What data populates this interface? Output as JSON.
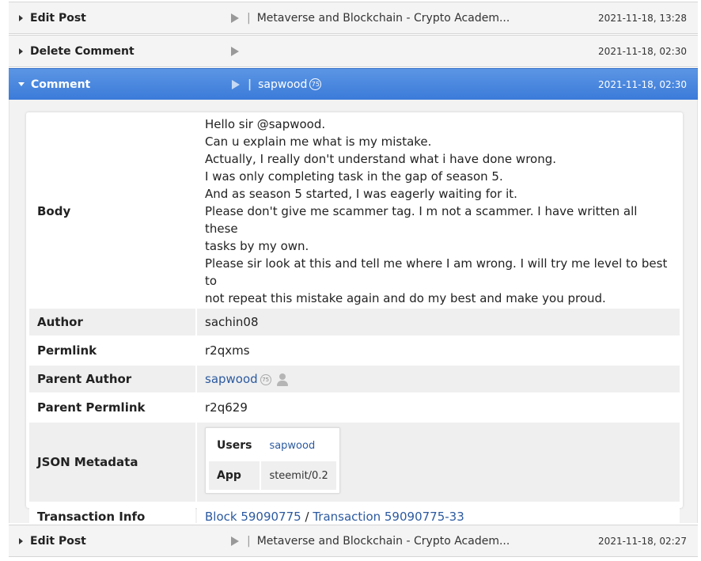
{
  "operations": [
    {
      "type": "Edit Post",
      "summary": "Metaverse and Blockchain - Crypto Academ...",
      "time": "2021-11-18, 13:28"
    },
    {
      "type": "Delete Comment",
      "summary": "",
      "time": "2021-11-18, 02:30"
    },
    {
      "type": "Comment",
      "summary": "sapwood",
      "reputation": "75",
      "time": "2021-11-18, 02:30"
    },
    {
      "type": "Edit Post",
      "summary": "Metaverse and Blockchain - Crypto Academ...",
      "time": "2021-11-18, 02:27"
    }
  ],
  "details": {
    "body_label": "Body",
    "body_lines": [
      "Hello sir @sapwood.",
      "Can u explain me what is my mistake.",
      "Actually, I really don't understand what i have done wrong.",
      "I was only completing task in the gap of season 5.",
      "And as season 5 started, I was eagerly waiting for it.",
      "Please don't give me scammer tag. I m not a scammer. I have written all these",
      "tasks by my own.",
      "Please sir look at this and tell me where I am wrong. I will try me level to best to",
      "not repeat this mistake again and do my best and make you proud."
    ],
    "author_label": "Author",
    "author": "sachin08",
    "permlink_label": "Permlink",
    "permlink": "r2qxms",
    "parent_author_label": "Parent Author",
    "parent_author": "sapwood",
    "parent_author_reputation": "75",
    "parent_permlink_label": "Parent Permlink",
    "parent_permlink": "r2q629",
    "json_metadata_label": "JSON Metadata",
    "json_metadata": {
      "users_label": "Users",
      "users": "sapwood",
      "app_label": "App",
      "app": "steemit/0.2"
    },
    "transaction_info_label": "Transaction Info",
    "block": "Block 59090775",
    "separator": "/",
    "transaction": "Transaction 59090775-33"
  },
  "colors": {
    "active_row": "#4a88e0",
    "link": "#2c5aa0",
    "row_alt": "#efefef"
  }
}
